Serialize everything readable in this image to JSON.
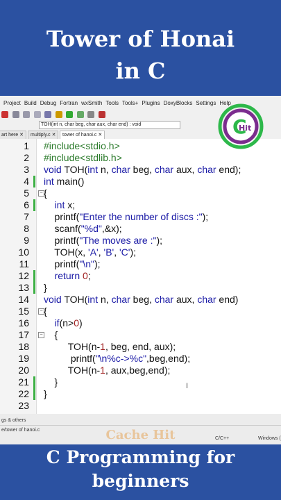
{
  "header": {
    "line1": "Tower of Honai",
    "line2": "in C"
  },
  "ide": {
    "menu": [
      "Project",
      "Build",
      "Debug",
      "Fortran",
      "wxSmith",
      "Tools",
      "Tools+",
      "Plugins",
      "DoxyBlocks",
      "Settings",
      "Help"
    ],
    "function_box": "TOH(int n, char beg, char aux, char end) : void",
    "tabs": [
      "art here",
      "multiply.c",
      "tower of hanoi.c"
    ],
    "active_tab": "tower of hanoi.c",
    "status_panel": "gs & others",
    "status_file": "e/tower of hanoi.c",
    "status_lang": "C/C++",
    "status_os": "Windows ("
  },
  "code_lines": [
    {
      "n": "1",
      "text": "#include<stdio.h>"
    },
    {
      "n": "2",
      "text": "#include<stdlib.h>"
    },
    {
      "n": "3",
      "text": "void TOH(int n, char beg, char aux, char end);"
    },
    {
      "n": "4",
      "text": "int main()"
    },
    {
      "n": "5",
      "text": "{"
    },
    {
      "n": "6",
      "text": "    int x;"
    },
    {
      "n": "7",
      "text": "    printf(\"Enter the number of discs :\");"
    },
    {
      "n": "8",
      "text": "    scanf(\"%d\",&x);"
    },
    {
      "n": "9",
      "text": "    printf(\"The moves are :\");"
    },
    {
      "n": "10",
      "text": "    TOH(x, 'A', 'B', 'C');"
    },
    {
      "n": "11",
      "text": "    printf(\"\\n\");"
    },
    {
      "n": "12",
      "text": "    return 0;"
    },
    {
      "n": "13",
      "text": "}"
    },
    {
      "n": "14",
      "text": "void TOH(int n, char beg, char aux, char end)"
    },
    {
      "n": "15",
      "text": "{"
    },
    {
      "n": "16",
      "text": "    if(n>0)"
    },
    {
      "n": "17",
      "text": "    {"
    },
    {
      "n": "18",
      "text": "         TOH(n-1, beg, end, aux);"
    },
    {
      "n": "19",
      "text": "          printf(\"\\n%c->%c\",beg,end);"
    },
    {
      "n": "20",
      "text": "         TOH(n-1, aux,beg,end);"
    },
    {
      "n": "21",
      "text": "    }"
    },
    {
      "n": "22",
      "text": "}"
    },
    {
      "n": "23",
      "text": ""
    }
  ],
  "logo": {
    "letter": "C",
    "text": "Hit",
    "colors": [
      "#2db84a",
      "#7b2d8e"
    ]
  },
  "watermark": "Cache Hit",
  "footer": {
    "line1": "C Programming for",
    "line2": "beginners"
  }
}
